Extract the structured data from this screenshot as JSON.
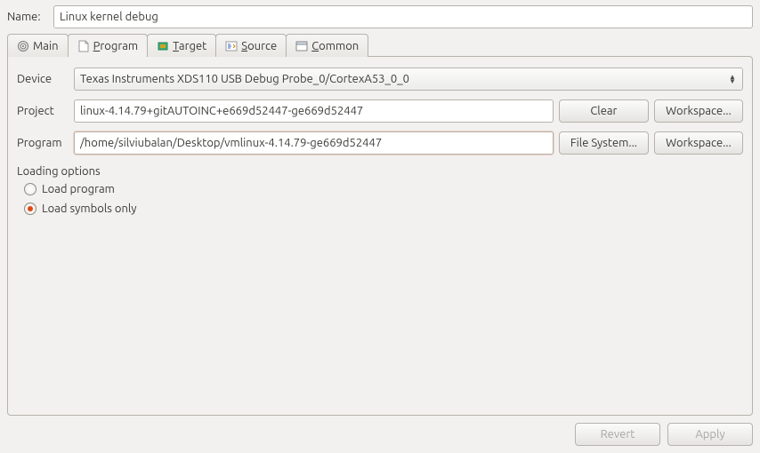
{
  "name_label": "Name:",
  "name_value": "Linux kernel debug",
  "tabs": {
    "main": "Main",
    "program": "Program",
    "target": "Target",
    "source": "Source",
    "common": "Common"
  },
  "form": {
    "device_label": "Device",
    "device_value": "Texas Instruments XDS110 USB Debug Probe_0/CortexA53_0_0",
    "project_label": "Project",
    "project_value": "linux-4.14.79+gitAUTOINC+e669d52447-ge669d52447",
    "program_label": "Program",
    "program_value": "/home/silviubalan/Desktop/vmlinux-4.14.79-ge669d52447",
    "clear_btn": "Clear",
    "workspace_btn": "Workspace...",
    "filesystem_btn": "File System..."
  },
  "loading": {
    "title": "Loading options",
    "load_program": "Load program",
    "load_symbols": "Load symbols only"
  },
  "footer": {
    "revert": "Revert",
    "apply": "Apply"
  }
}
